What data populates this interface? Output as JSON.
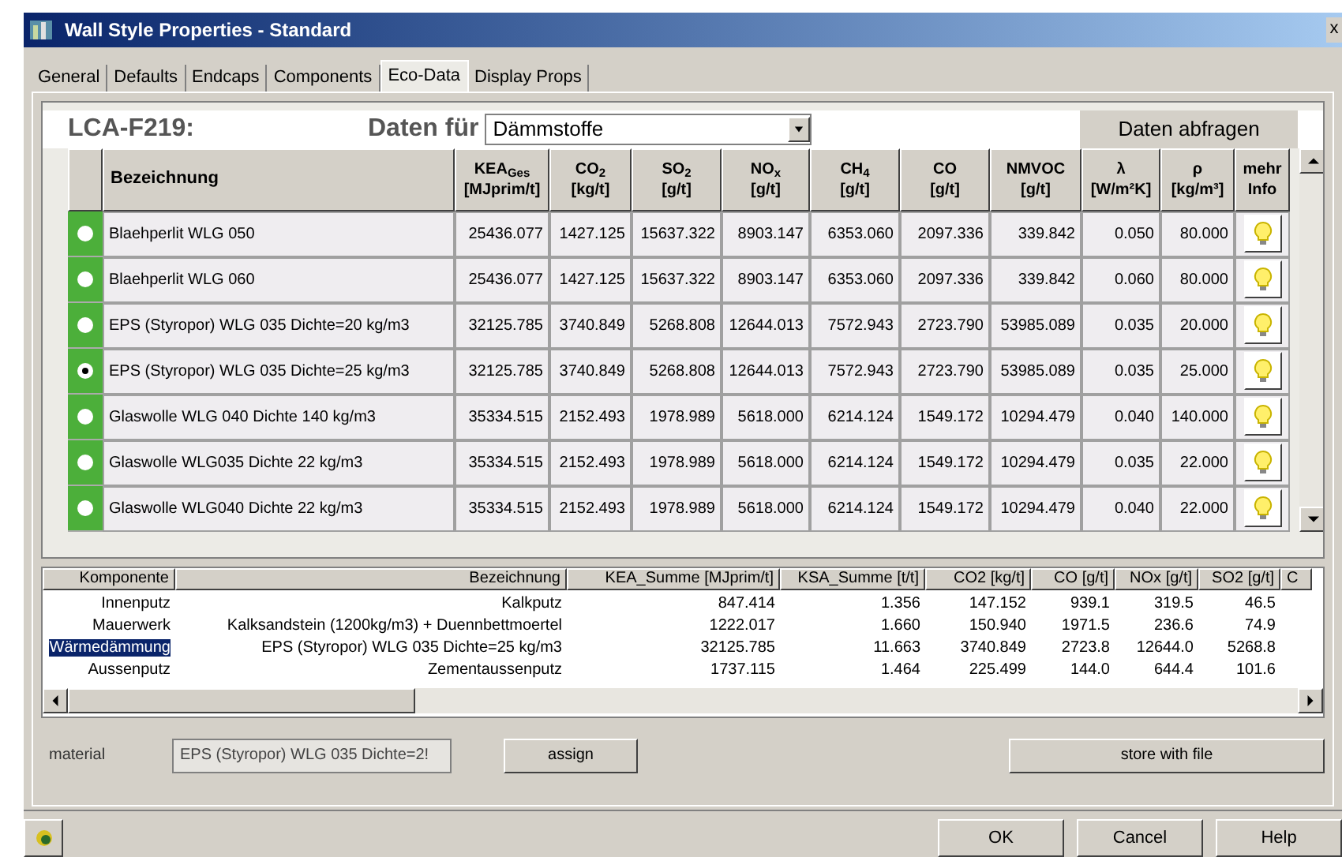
{
  "window": {
    "title": "Wall Style Properties - Standard",
    "close": "x"
  },
  "tabs": [
    {
      "label": "General",
      "selected": false
    },
    {
      "label": "Defaults",
      "selected": false
    },
    {
      "label": "Endcaps",
      "selected": false
    },
    {
      "label": "Components",
      "selected": false
    },
    {
      "label": "Eco-Data",
      "selected": true
    },
    {
      "label": "Display Props",
      "selected": false
    }
  ],
  "lca": {
    "code": "LCA-F219:",
    "data_for_label": "Daten für",
    "category": "Dämmstoffe",
    "query_button": "Daten abfragen"
  },
  "materials_table": {
    "columns": [
      "Bezeichnung",
      "KEA$_{Ges}$ [MJprim/t]",
      "CO$_{2}$ [kg/t]",
      "SO$_{2}$ [g/t]",
      "NO$_{x}$ [g/t]",
      "CH$_{4}$ [g/t]",
      "CO [g/t]",
      "NMVOC [g/t]",
      "λ [W/m²K]",
      "ρ [kg/m³]",
      "mehr Info"
    ],
    "rows": [
      {
        "selected": false,
        "cells": [
          "Blaehperlit WLG 050",
          "25436.077",
          "1427.125",
          "15637.322",
          "8903.147",
          "6353.060",
          "2097.336",
          "339.842",
          "0.050",
          "80.000"
        ]
      },
      {
        "selected": false,
        "cells": [
          "Blaehperlit WLG 060",
          "25436.077",
          "1427.125",
          "15637.322",
          "8903.147",
          "6353.060",
          "2097.336",
          "339.842",
          "0.060",
          "80.000"
        ]
      },
      {
        "selected": false,
        "cells": [
          "EPS (Styropor) WLG 035 Dichte=20 kg/m3",
          "32125.785",
          "3740.849",
          "5268.808",
          "12644.013",
          "7572.943",
          "2723.790",
          "53985.089",
          "0.035",
          "20.000"
        ]
      },
      {
        "selected": true,
        "cells": [
          "EPS (Styropor) WLG 035 Dichte=25 kg/m3",
          "32125.785",
          "3740.849",
          "5268.808",
          "12644.013",
          "7572.943",
          "2723.790",
          "53985.089",
          "0.035",
          "25.000"
        ]
      },
      {
        "selected": false,
        "cells": [
          "Glaswolle WLG 040 Dichte 140 kg/m3",
          "35334.515",
          "2152.493",
          "1978.989",
          "5618.000",
          "6214.124",
          "1549.172",
          "10294.479",
          "0.040",
          "140.000"
        ]
      },
      {
        "selected": false,
        "cells": [
          "Glaswolle WLG035 Dichte 22 kg/m3",
          "35334.515",
          "2152.493",
          "1978.989",
          "5618.000",
          "6214.124",
          "1549.172",
          "10294.479",
          "0.035",
          "22.000"
        ]
      },
      {
        "selected": false,
        "cells": [
          "Glaswolle WLG040 Dichte 22 kg/m3",
          "35334.515",
          "2152.493",
          "1978.989",
          "5618.000",
          "6214.124",
          "1549.172",
          "10294.479",
          "0.040",
          "22.000"
        ]
      }
    ]
  },
  "components_list": {
    "columns": [
      "Komponente",
      "Bezeichnung",
      "KEA_Summe [MJprim/t]",
      "KSA_Summe [t/t]",
      "CO2 [kg/t]",
      "CO [g/t]",
      "NOx [g/t]",
      "SO2 [g/t]",
      "C"
    ],
    "rows": [
      {
        "selected": false,
        "cells": [
          "Innenputz",
          "Kalkputz",
          "847.414",
          "1.356",
          "147.152",
          "939.1",
          "319.5",
          "46.5"
        ]
      },
      {
        "selected": false,
        "cells": [
          "Mauerwerk",
          "Kalksandstein (1200kg/m3) + Duennbettmoertel",
          "1222.017",
          "1.660",
          "150.940",
          "1971.5",
          "236.6",
          "74.9"
        ]
      },
      {
        "selected": true,
        "cells": [
          "Wärmedämmung",
          "EPS (Styropor) WLG 035 Dichte=25 kg/m3",
          "32125.785",
          "11.663",
          "3740.849",
          "2723.8",
          "12644.0",
          "5268.8"
        ]
      },
      {
        "selected": false,
        "cells": [
          "Aussenputz",
          "Zementaussenputz",
          "1737.115",
          "1.464",
          "225.499",
          "144.0",
          "644.4",
          "101.6"
        ]
      }
    ]
  },
  "material": {
    "label": "material",
    "value": "EPS (Styropor) WLG 035 Dichte=2!",
    "assign_button": "assign",
    "store_button": "store with file"
  },
  "buttons": [
    "OK",
    "Cancel",
    "Help"
  ]
}
